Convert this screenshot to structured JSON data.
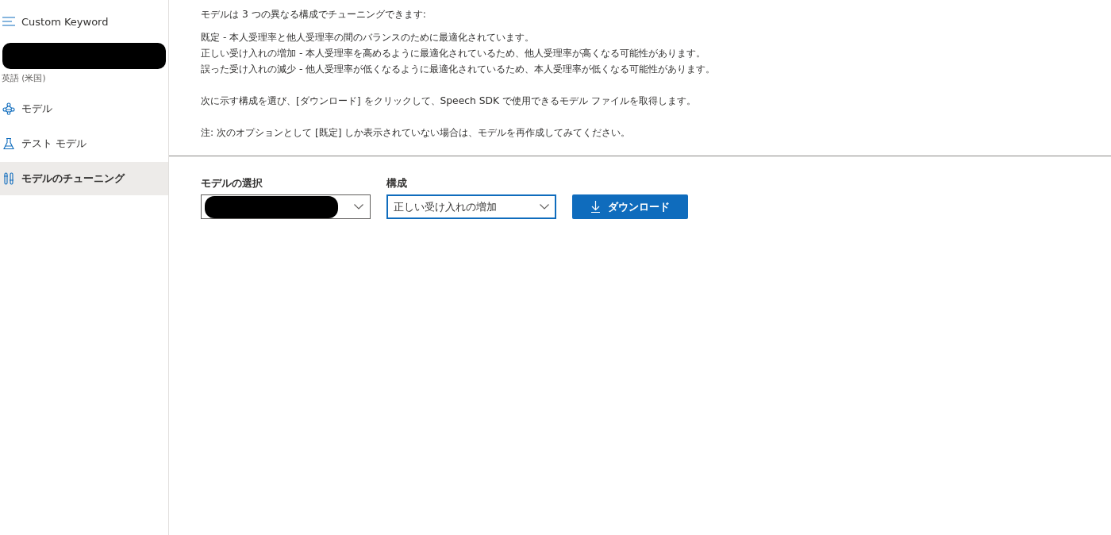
{
  "sidebar": {
    "title": "Custom Keyword",
    "project": {
      "redacted": true,
      "language": "英語 (米国)"
    },
    "items": [
      {
        "label": "モデル",
        "kind": "model",
        "selected": false
      },
      {
        "label": "テスト モデル",
        "kind": "test",
        "selected": false
      },
      {
        "label": "モデルのチューニング",
        "kind": "tuning",
        "selected": true
      }
    ]
  },
  "main": {
    "intro": "モデルは 3 つの異なる構成でチューニングできます:",
    "options": [
      "既定 - 本人受理率と他人受理率の間のバランスのために最適化されています。",
      "正しい受け入れの増加 - 本人受理率を高めるように最適化されているため、他人受理率が高くなる可能性があります。",
      "誤った受け入れの減少 - 他人受理率が低くなるように最適化されているため、本人受理率が低くなる可能性があります。"
    ],
    "instruction": "次に示す構成を選び、[ダウンロード] をクリックして、Speech SDK で使用できるモデル ファイルを取得します。",
    "note": "注: 次のオプションとして [既定] しか表示されていない場合は、モデルを再作成してみてください。",
    "fields": [
      {
        "label": "モデルの選択",
        "redacted": true,
        "focused": false
      },
      {
        "label": "構成",
        "value": "正しい受け入れの増加",
        "focused": true
      }
    ],
    "download_button": "ダウンロード"
  }
}
